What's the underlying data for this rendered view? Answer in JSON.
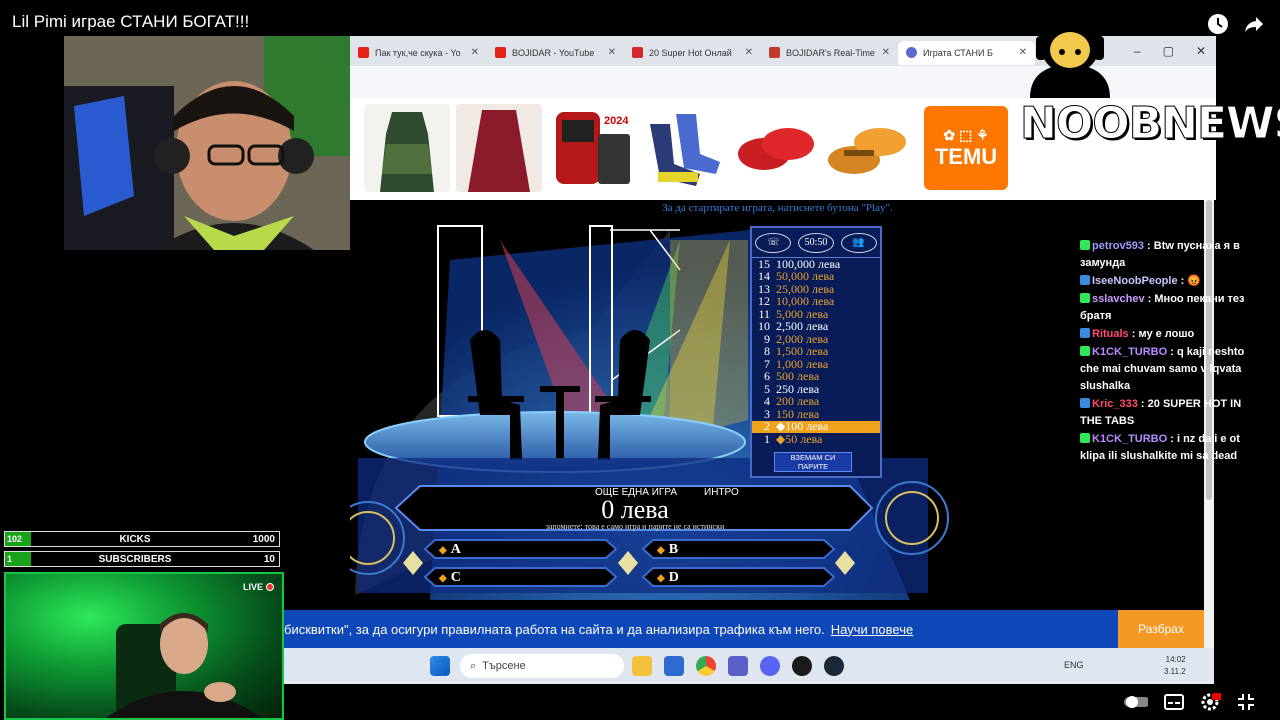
{
  "video": {
    "title": "Lil Pimi играе СТАНИ БОГАТ!!!"
  },
  "browser": {
    "tabs": [
      {
        "label": "Пак тук,че скука - Yo",
        "color": "#e62117"
      },
      {
        "label": "BOJIDAR - YouTube",
        "color": "#e62117"
      },
      {
        "label": "20 Super Hot Онлай",
        "color": "#d9262c"
      },
      {
        "label": "BOJIDAR's Real-Time",
        "color": "#c0392b"
      },
      {
        "label": "Играта СТАНИ Б",
        "color": "#5a6bd0"
      }
    ],
    "ad_brand": "TEMU"
  },
  "logo": {
    "text": "NOOBNEWS"
  },
  "game": {
    "hint": "За да стартирате играта, натиснете бутона \"Play\".",
    "lifelines": [
      "☏",
      "50:50",
      "👥"
    ],
    "ladder": [
      {
        "n": "15",
        "v": "100,000 лева",
        "milestone": true
      },
      {
        "n": "14",
        "v": "50,000 лева"
      },
      {
        "n": "13",
        "v": "25,000 лева"
      },
      {
        "n": "12",
        "v": "10,000 лева"
      },
      {
        "n": "11",
        "v": "5,000 лева"
      },
      {
        "n": "10",
        "v": "2,500 лева",
        "milestone": true
      },
      {
        "n": "9",
        "v": "2,000 лева"
      },
      {
        "n": "8",
        "v": "1,500 лева"
      },
      {
        "n": "7",
        "v": "1,000 лева"
      },
      {
        "n": "6",
        "v": "500 лева"
      },
      {
        "n": "5",
        "v": "250 лева",
        "milestone": true
      },
      {
        "n": "4",
        "v": "200 лева"
      },
      {
        "n": "3",
        "v": "150 лева"
      },
      {
        "n": "2",
        "v": "◆100 лева",
        "current": true
      },
      {
        "n": "1",
        "v": "◆50 лева"
      }
    ],
    "take_money": "ВЗЕМАМ СИ ПАРИТЕ",
    "prize": "0 лева",
    "new_game": "ОЩЕ ЕДНА ИГРА",
    "intro": "ИНТРО",
    "note": "запомнете: това е само игра и парите не са истински",
    "answers": [
      "A",
      "B",
      "C",
      "D"
    ]
  },
  "cookie": {
    "text": "бисквитки\", за да осигури правилната работа на сайта и да анализира трафика към него.",
    "link": "Научи повече",
    "button": "Разбрах"
  },
  "taskbar": {
    "search_placeholder": "Търсене",
    "lang": "ENG",
    "time": "14:02",
    "date": "3.11.2"
  },
  "chat": [
    {
      "user": "petrov593",
      "text": "Btw пуснаха я в замунда",
      "color": "#9b9bff"
    },
    {
      "user": "IseeNoobPeople",
      "text": "",
      "color": "#c6c6ff"
    },
    {
      "user": "sslavchev",
      "text": "Мноо пекани тез братя",
      "color": "#c79bff"
    },
    {
      "user": "Rituals",
      "text": "му е лошо",
      "color": "#ff4d6a"
    },
    {
      "user": "K1CK_TURBO",
      "text": "q kaji neshto che mai chuvam samo v lqvata slushalka",
      "color": "#b78cff"
    },
    {
      "user": "Kric_333",
      "text": "20 SUPER HOT IN THE TABS",
      "color": "#ff4d6a"
    },
    {
      "user": "K1CK_TURBO",
      "text": "i nz dali e ot klipa ili slushalkite mi sa dead",
      "color": "#b78cff"
    }
  ],
  "stats": [
    {
      "count": "102",
      "label": "KICKS",
      "value": "1000"
    },
    {
      "count": "1",
      "label": "SUBSCRIBERS",
      "value": "10"
    }
  ],
  "live_label": "LIVE"
}
